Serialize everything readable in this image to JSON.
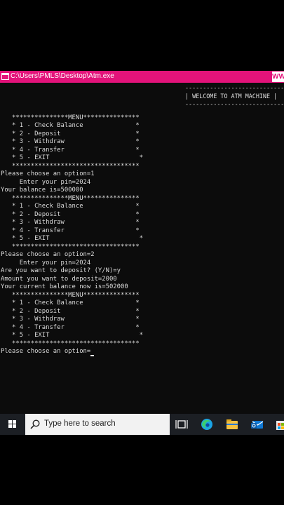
{
  "window": {
    "title": "C:\\Users\\PMLS\\Desktop\\Atm.exe",
    "cut_logo": "WW"
  },
  "console": {
    "banner_lines": [
      "----------------------------",
      "| WELCOME TO ATM MACHINE |",
      "----------------------------"
    ],
    "lines": [
      "",
      "   ***************MENU***************",
      "   * 1 - Check Balance              *",
      "   * 2 - Deposit                    *",
      "   * 3 - Withdraw                   *",
      "   * 4 - Transfer                   *",
      "   * 5 - EXIT                        *",
      "   **********************************",
      "Please choose an option=1",
      "     Enter your pin=2024",
      "Your balance is=500000",
      "   ***************MENU***************",
      "   * 1 - Check Balance              *",
      "   * 2 - Deposit                    *",
      "   * 3 - Withdraw                   *",
      "   * 4 - Transfer                   *",
      "   * 5 - EXIT                        *",
      "   **********************************",
      "Please choose an option=2",
      "     Enter your pin=2024",
      "Are you want to deposit? (Y/N)=y",
      "Amount you want to deposit=2000",
      "Your current balance now is=502000",
      "   ***************MENU***************",
      "   * 1 - Check Balance              *",
      "   * 2 - Deposit                    *",
      "   * 3 - Withdraw                   *",
      "   * 4 - Transfer                   *",
      "   * 5 - EXIT                        *",
      "   **********************************"
    ],
    "prompt": "Please choose an option="
  },
  "taskbar": {
    "search_placeholder": "Type here to search",
    "icons": [
      "windows-start-icon",
      "search-icon",
      "task-view-icon",
      "edge-icon",
      "file-explorer-icon",
      "mail-icon",
      "store-icon"
    ]
  },
  "colors": {
    "titlebar": "#e3137a",
    "console_bg": "#0c0c0c",
    "console_text": "#dcdcdc",
    "taskbar": "#1c1f24",
    "search_box": "#f2f2f2"
  }
}
